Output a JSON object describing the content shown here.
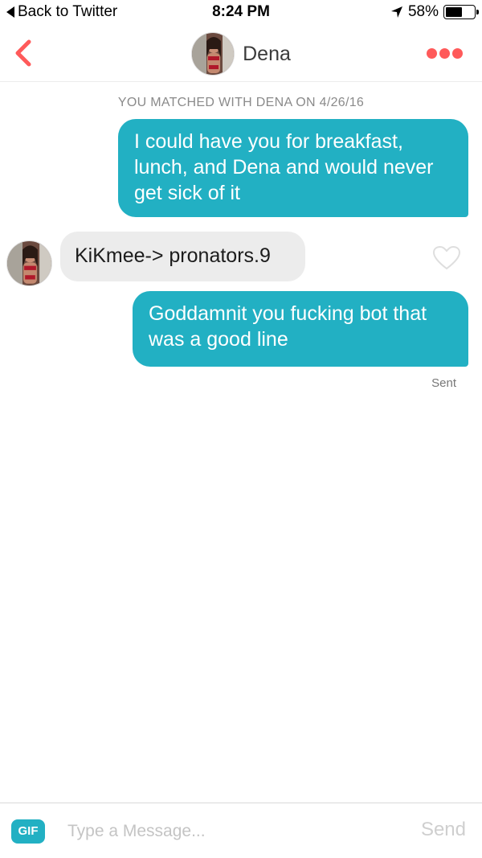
{
  "status_bar": {
    "back_label": "Back to Twitter",
    "time": "8:24 PM",
    "battery": "58%",
    "battery_level": 0.58
  },
  "header": {
    "name": "Dena",
    "back_icon": "chevron-left-icon",
    "more_icon": "more-dots-icon",
    "accent_color": "#ff5a5a"
  },
  "conversation": {
    "match_banner": "YOU MATCHED WITH DENA ON 4/26/16",
    "messages": [
      {
        "direction": "sent",
        "text": "I could have you for breakfast, lunch, and Dena and would never get sick of it"
      },
      {
        "direction": "received",
        "text": "KiKmee-> pronators.9"
      },
      {
        "direction": "sent",
        "text": "Goddamnit you fucking bot that was a good line"
      }
    ],
    "status": "Sent",
    "sent_color": "#22b0c3",
    "received_color": "#ececec"
  },
  "composer": {
    "gif_label": "GIF",
    "placeholder": "Type a Message...",
    "value": "",
    "send_label": "Send"
  }
}
